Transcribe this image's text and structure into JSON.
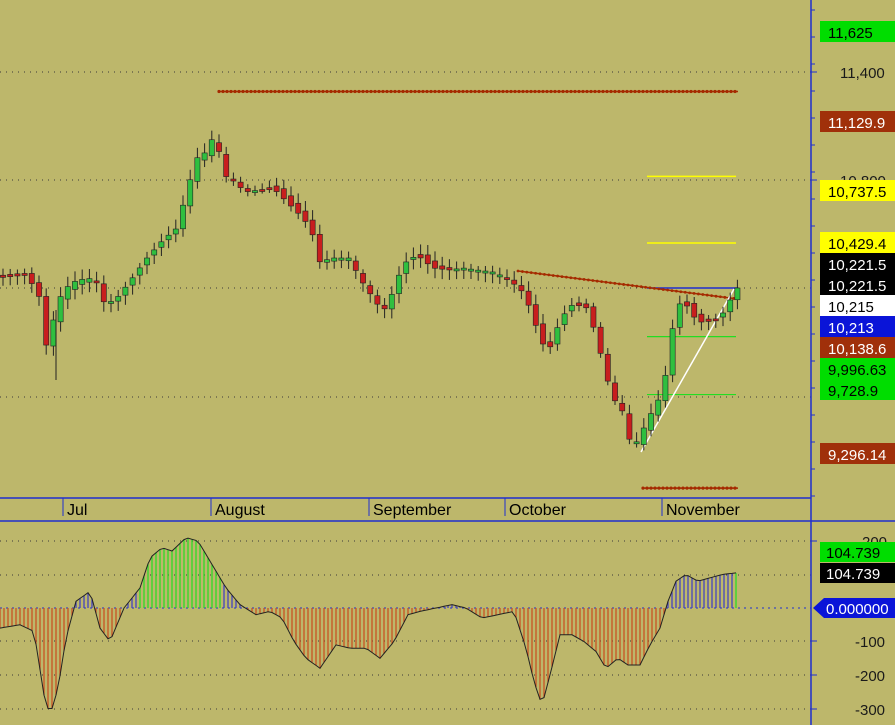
{
  "colors": {
    "background": "#bdb76b",
    "axis_blue": "#1f2fd0",
    "up_candle": "#2fbf3f",
    "down_candle": "#c81e1e",
    "pivot_dots": "#a52a00",
    "target_green": "#22dd22",
    "fib_yellow": "#ffff00",
    "hist_positive": "#3a3ac8",
    "hist_negative": "#c84a1e",
    "hist_green": "#22dd22"
  },
  "chart_data": [
    {
      "type": "candlestick",
      "title": "",
      "xlabel": "",
      "ylabel": "",
      "x_months": [
        "Jul",
        "August",
        "September",
        "October",
        "November"
      ],
      "ylim": [
        9050,
        11700
      ],
      "y_ticks": [
        "11,400",
        "10,800"
      ],
      "price_tags": [
        {
          "value": 11625,
          "label": "11,625",
          "bg": "#00dd00",
          "fg": "#000000"
        },
        {
          "value": 11129.9,
          "label": "11,129.9",
          "bg": "#a0300a",
          "fg": "#ffffff"
        },
        {
          "value": 10737.5,
          "label": "10,737.5",
          "bg": "#ffff00",
          "fg": "#000000"
        },
        {
          "value": 10429.4,
          "label": "10,429.4",
          "bg": "#ffff00",
          "fg": "#000000"
        },
        {
          "value": 10221.5,
          "label": "10,221.5",
          "bg": "#000000",
          "fg": "#ffffff"
        },
        {
          "value": 10221.5,
          "label": "10,221.5",
          "bg": "#000000",
          "fg": "#ffffff"
        },
        {
          "value": 10215,
          "label": "10,215",
          "bg": "#ffffff",
          "fg": "#000000"
        },
        {
          "value": 10213,
          "label": "10,213",
          "bg": "#0a14d8",
          "fg": "#ffffff"
        },
        {
          "value": 10138.6,
          "label": "10,138.6",
          "bg": "#a0300a",
          "fg": "#ffffff"
        },
        {
          "value": 9996.63,
          "label": "9,996.63",
          "bg": "#00dd00",
          "fg": "#000000"
        },
        {
          "value": 9728.9,
          "label": "9,728.9",
          "bg": "#00dd00",
          "fg": "#000000"
        },
        {
          "value": 9296.14,
          "label": "9,296.14",
          "bg": "#a0300a",
          "fg": "#ffffff"
        }
      ],
      "overlay_levels": [
        {
          "value": 11625,
          "style": "green-dotted"
        },
        {
          "value": 11129.9,
          "style": "brown-dotted"
        },
        {
          "value": 10737.5,
          "style": "yellow"
        },
        {
          "value": 10429.4,
          "style": "yellow"
        },
        {
          "value": 10221.5,
          "style": "blue"
        },
        {
          "value": 9996.63,
          "style": "green"
        },
        {
          "value": 9728.9,
          "style": "green"
        },
        {
          "value": 9296.14,
          "style": "brown-dotted"
        }
      ]
    },
    {
      "type": "histogram",
      "title": "",
      "ylim": [
        -330,
        230
      ],
      "y_ticks": [
        "200",
        "-100",
        "-200",
        "-300"
      ],
      "price_tags": [
        {
          "value": 104.739,
          "label": "104.739",
          "bg": "#00dd00",
          "fg": "#000000"
        },
        {
          "value": 104.739,
          "label": "104.739",
          "bg": "#000000",
          "fg": "#ffffff"
        },
        {
          "value": 0,
          "label": "0.000000",
          "bg": "#0a14d8",
          "fg": "#ffffff"
        }
      ]
    }
  ]
}
